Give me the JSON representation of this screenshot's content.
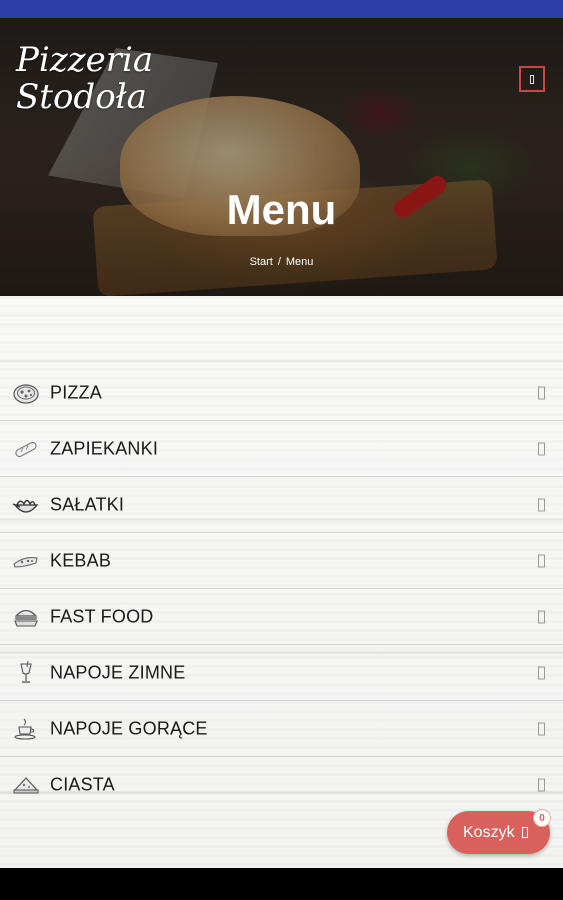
{
  "header": {
    "logo_line1": "Pizzeria",
    "logo_line2": "Stodoła",
    "title": "Menu",
    "breadcrumb": {
      "home": "Start",
      "separator": "/",
      "current": "Menu"
    },
    "menu_icon": "hamburger-icon"
  },
  "categories": [
    {
      "label": "PIZZA",
      "icon": "pizza-icon"
    },
    {
      "label": "ZAPIEKANKI",
      "icon": "baguette-icon"
    },
    {
      "label": "SAŁATKI",
      "icon": "salad-bowl-icon"
    },
    {
      "label": "KEBAB",
      "icon": "kebab-wrap-icon"
    },
    {
      "label": "FAST FOOD",
      "icon": "burger-icon"
    },
    {
      "label": "NAPOJE ZIMNE",
      "icon": "cold-drink-icon"
    },
    {
      "label": "NAPOJE GORĄCE",
      "icon": "hot-drink-icon"
    },
    {
      "label": "CIASTA",
      "icon": "cake-icon"
    }
  ],
  "cart": {
    "label": "Koszyk",
    "count": "0",
    "icon": "cart-icon"
  },
  "colors": {
    "status_bar": "#2e3da8",
    "accent": "#d9615b",
    "menu_toggle_border": "#c04a45",
    "text_dark": "#1a1a1a"
  }
}
